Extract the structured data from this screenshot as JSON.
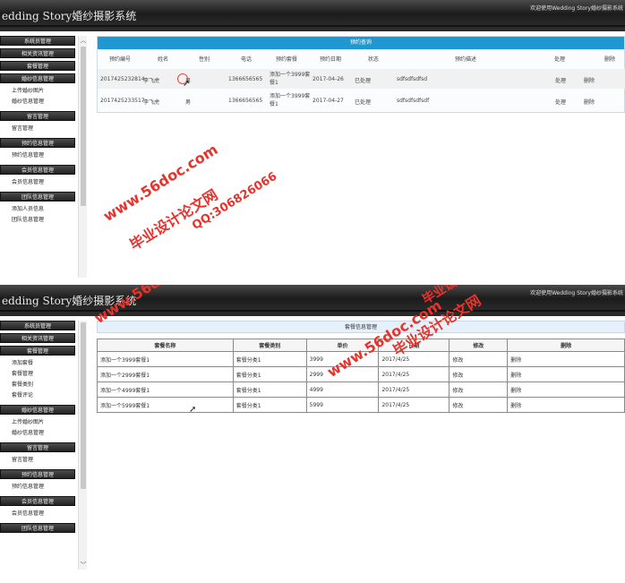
{
  "app": {
    "title": "edding Story婚纱摄影系统",
    "welcome": "欢迎使用Wedding Story婚纱摄影系统"
  },
  "sidebar_top": {
    "items": [
      {
        "type": "head",
        "label": "系统员管理"
      },
      {
        "type": "head",
        "label": "相关资讯管理"
      },
      {
        "type": "head",
        "label": "套餐管理"
      },
      {
        "type": "head",
        "label": "婚纱信息管理"
      },
      {
        "type": "item",
        "label": "上传婚纱图片"
      },
      {
        "type": "item",
        "label": "婚纱信息管理"
      },
      {
        "type": "head",
        "label": "留言管理"
      },
      {
        "type": "item",
        "label": "留言管理"
      },
      {
        "type": "head",
        "label": "预约信息管理"
      },
      {
        "type": "item",
        "label": "预约信息管理"
      },
      {
        "type": "head",
        "label": "会员信息管理"
      },
      {
        "type": "item",
        "label": "会员信息管理"
      },
      {
        "type": "head",
        "label": "团队信息管理"
      },
      {
        "type": "item",
        "label": "添加人员信息"
      },
      {
        "type": "item",
        "label": "团队信息管理"
      }
    ]
  },
  "sidebar_bottom": {
    "items": [
      {
        "type": "head",
        "label": "系统员管理"
      },
      {
        "type": "head",
        "label": "相关资讯管理"
      },
      {
        "type": "head",
        "label": "套餐管理"
      },
      {
        "type": "item",
        "label": "添加套餐"
      },
      {
        "type": "item",
        "label": "套餐管理"
      },
      {
        "type": "item",
        "label": "套餐类别"
      },
      {
        "type": "item",
        "label": "套餐评论"
      },
      {
        "type": "head",
        "label": "婚纱信息管理"
      },
      {
        "type": "item",
        "label": "上传婚纱图片"
      },
      {
        "type": "item",
        "label": "婚纱信息管理"
      },
      {
        "type": "head",
        "label": "留言管理"
      },
      {
        "type": "item",
        "label": "留言管理"
      },
      {
        "type": "head",
        "label": "预约信息管理"
      },
      {
        "type": "item",
        "label": "预约信息管理"
      },
      {
        "type": "head",
        "label": "会员信息管理"
      },
      {
        "type": "item",
        "label": "会员信息管理"
      },
      {
        "type": "head",
        "label": "团队信息管理"
      }
    ]
  },
  "booking": {
    "caption": "预约查询",
    "headers": [
      "预约编号",
      "姓名",
      "性别",
      "电话",
      "预约套餐",
      "预约日期",
      "状态",
      "预约描述",
      "处理",
      "删除"
    ],
    "rows": [
      {
        "id": "2017425232814",
        "name": "李飞虎",
        "gender": "男",
        "phone": "1366656565",
        "package": "添加一个3999套餐1",
        "date": "2017-04-26",
        "status": "已处理",
        "desc": "sdfsdfsdfsd",
        "handle": "处理",
        "delete": "删除"
      },
      {
        "id": "2017425233517",
        "name": "李飞虎",
        "gender": "男",
        "phone": "1366656565",
        "package": "添加一个3999套餐1",
        "date": "2017-04-27",
        "status": "已处理",
        "desc": "sdfsdfsdfsdf",
        "handle": "处理",
        "delete": "删除"
      }
    ]
  },
  "packages": {
    "caption": "套餐信息管理",
    "headers": [
      "套餐名称",
      "套餐类别",
      "单价",
      "日期",
      "修改",
      "删除"
    ],
    "rows": [
      {
        "name": "添加一个3999套餐1",
        "category": "套餐分类1",
        "price": "3999",
        "date": "2017/4/25",
        "edit": "修改",
        "delete": "删除"
      },
      {
        "name": "添加一个2999套餐1",
        "category": "套餐分类1",
        "price": "2999",
        "date": "2017/4/25",
        "edit": "修改",
        "delete": "删除"
      },
      {
        "name": "添加一个4999套餐1",
        "category": "套餐分类1",
        "price": "4999",
        "date": "2017/4/25",
        "edit": "修改",
        "delete": "删除"
      },
      {
        "name": "添加一个5999套餐1",
        "category": "套餐分类1",
        "price": "5999",
        "date": "2017/4/25",
        "edit": "修改",
        "delete": "删除"
      }
    ]
  },
  "watermark": {
    "site": "www.56doc.com",
    "qq": "QQ:306826066",
    "text": "毕业设计论文网"
  },
  "icons": {
    "scroll_up": "chevron-up-icon",
    "scroll_down": "chevron-down-icon",
    "cursor": "mouse-pointer-icon"
  },
  "colors": {
    "header_dark": "#1b1b1b",
    "caption_blue": "#1f98d2",
    "watermark_red": "#e8332d"
  }
}
